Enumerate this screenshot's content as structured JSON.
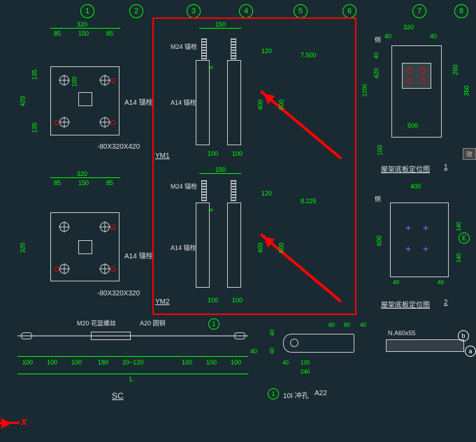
{
  "gridLabels": [
    "1",
    "2",
    "3",
    "4",
    "5",
    "6",
    "7",
    "8"
  ],
  "top": {
    "plateA": {
      "overall": "320",
      "cells": [
        "85",
        "150",
        "85"
      ],
      "h1": "135",
      "h2": "420",
      "h3": "135",
      "inner": "100",
      "anno": "A14 锚栓",
      "tag": "-80X320X420"
    },
    "plateB": {
      "overall": "320",
      "cells": [
        "85",
        "150",
        "85"
      ],
      "h": "320",
      "anno": "A14 锚栓",
      "tag": "-80X320X320"
    }
  },
  "center": {
    "top": {
      "title": "YM1",
      "overall": "150",
      "bolt": "M24 锚栓",
      "anchor": "A14 锚栓",
      "dTop": "120",
      "dInner": "400",
      "dSide": "600",
      "dSideR": "8",
      "level": "7.500",
      "bot": [
        "100",
        "100"
      ]
    },
    "bot": {
      "title": "YM2",
      "overall": "150",
      "bolt": "M24 锚栓",
      "anchor": "A14 锚栓",
      "dTop": "120",
      "dInner": "400",
      "dSide": "600",
      "dSideR": "8",
      "level": "8.225",
      "bot": [
        "100",
        "100"
      ]
    }
  },
  "right": {
    "plan1": {
      "title": "屋架底板定位图",
      "num": "1",
      "w": "320",
      "wl": "40",
      "wr": "40",
      "h": "420",
      "h2": "250",
      "h3": "350",
      "bot": "500",
      "tag": "侧",
      "dInner": "100",
      "dLeft": "1200"
    },
    "plan2": {
      "title": "屋架底板定位图",
      "num": "2",
      "w": "400",
      "h": "600",
      "h2": "140",
      "h3": "140",
      "wl": "40",
      "wr": "40",
      "tag": "侧",
      "mark": "E"
    }
  },
  "sc": {
    "title": "SC",
    "bolt": "M20 花篮螺丝",
    "rod": "A20 圆钢",
    "dims": [
      "100",
      "100",
      "100",
      "180",
      "20~120",
      "100",
      "100",
      "100"
    ],
    "tail": "40",
    "L": "L",
    "circled": "1"
  },
  "detail": {
    "d1": "40",
    "d2": "40",
    "w1": "40",
    "w2": "100",
    "w3": "240",
    "w4": "60",
    "w5": "80",
    "w6": "40",
    "title": "10I 冲孔",
    "sub": "A22",
    "circled": "1"
  },
  "corner": {
    "tag": "N.A60x55",
    "a": "a",
    "b": "b"
  },
  "ucs": {
    "x": "X",
    "arrow": ">"
  },
  "sideTab": "效"
}
